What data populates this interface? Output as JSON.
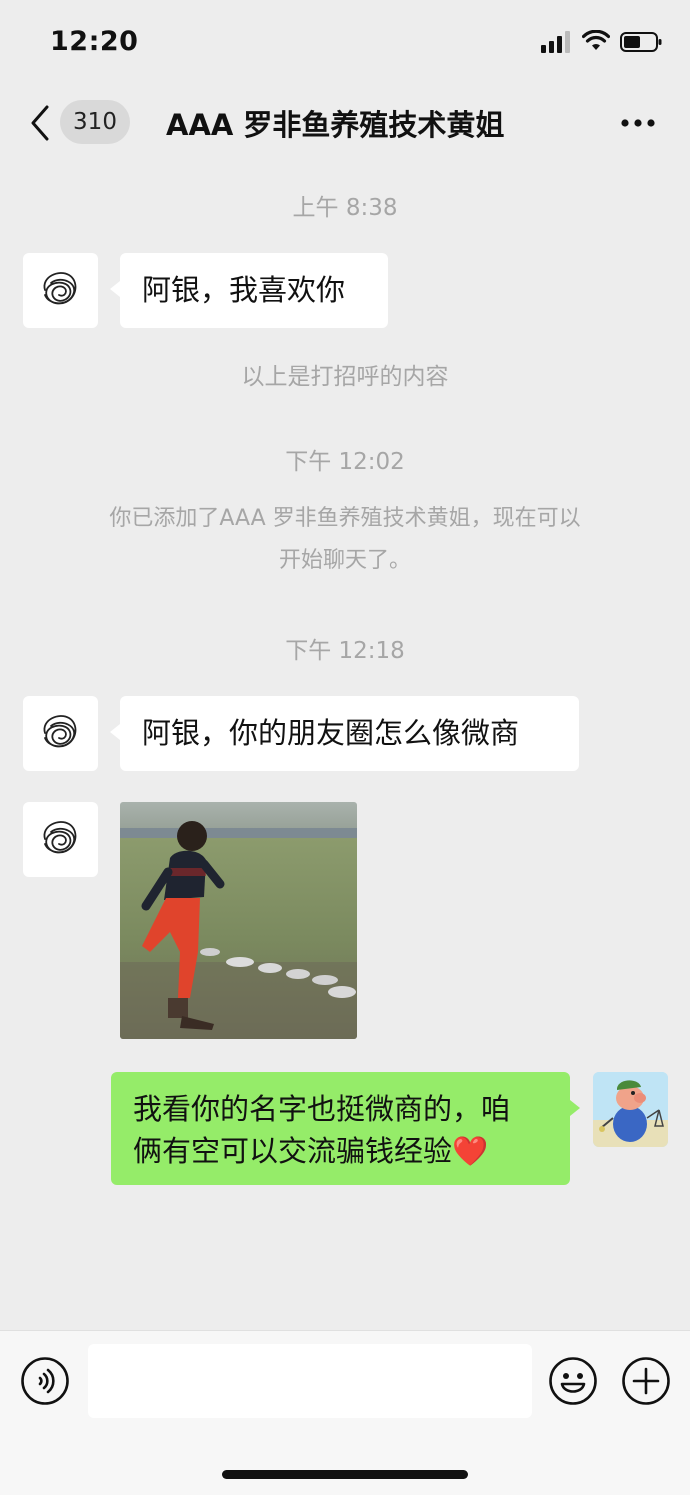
{
  "status_bar": {
    "time": "12:20"
  },
  "header": {
    "unread_count": "310",
    "title": "AAA 罗非鱼养殖技术黄姐"
  },
  "messages": {
    "ts1": "上午 8:38",
    "msg1": "阿银，我喜欢你",
    "sys1": "以上是打招呼的内容",
    "ts2": "下午 12:02",
    "sys2_line1": "你已添加了AAA 罗非鱼养殖技术黄姐，现在可以",
    "sys2_line2": "开始聊天了。",
    "ts3": "下午 12:18",
    "msg2": "阿银，你的朋友圈怎么像微商",
    "msg4_line1": "我看你的名字也挺微商的，咱",
    "msg4_line2": "俩有空可以交流骗钱经验",
    "msg4_emoji": "❤️"
  },
  "colors": {
    "background": "#ededed",
    "outgoing_bubble": "#95ec69",
    "incoming_bubble": "#ffffff",
    "timestamp_text": "#a6a6a6"
  },
  "icons": {
    "back": "chevron-left-icon",
    "more": "more-dots-icon",
    "voice": "voice-icon",
    "emoji": "emoji-icon",
    "add": "plus-icon"
  }
}
